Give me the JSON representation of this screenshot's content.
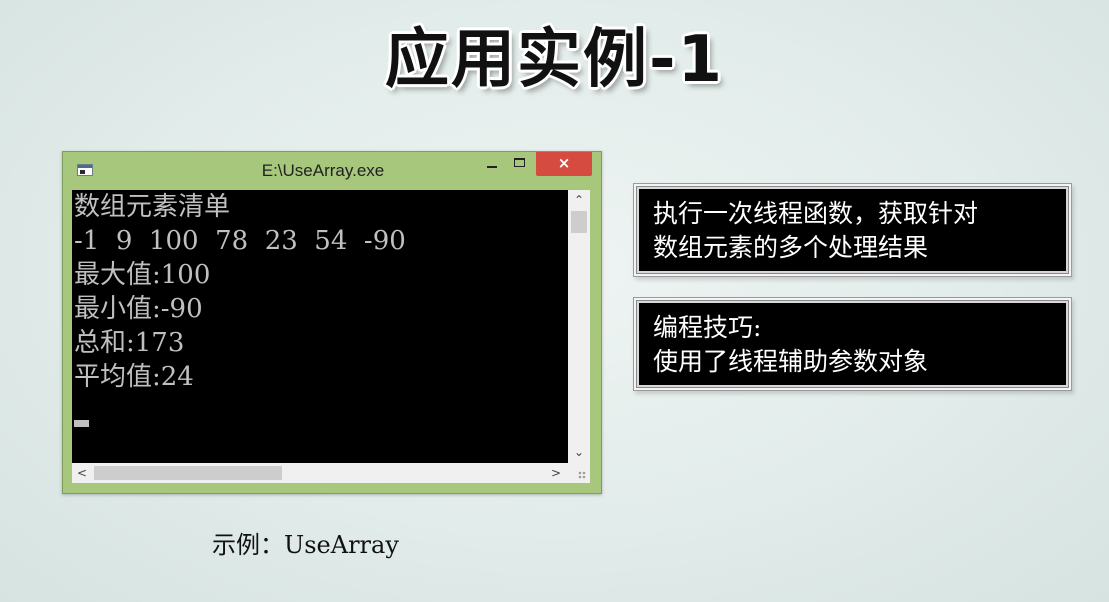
{
  "slide": {
    "title": "应用实例-1",
    "caption": "示例：UseArray"
  },
  "window": {
    "title": "E:\\UseArray.exe",
    "close_glyph": "×",
    "icons": {
      "app": "console-app-icon",
      "minimize": "minimize-icon",
      "maximize": "maximize-icon",
      "close": "close-icon"
    }
  },
  "console": {
    "lines": [
      "数组元素清单",
      "-1  9  100  78  23  54  -90",
      "最大值:100",
      "最小值:-90",
      "总和:173",
      "平均值:24"
    ]
  },
  "scrollbars": {
    "up_glyph": "⌃",
    "down_glyph": "⌄",
    "left_glyph": "<",
    "right_glyph": ">"
  },
  "notes": [
    {
      "lines": [
        "执行一次线程函数，获取针对",
        "数组元素的多个处理结果"
      ]
    },
    {
      "lines": [
        "编程技巧:",
        "使用了线程辅助参数对象"
      ]
    }
  ],
  "colors": {
    "window_frame": "#a7c77d",
    "close_button": "#d54b40",
    "console_background": "#000000",
    "console_text": "#c0c0c0",
    "note_background": "#000000",
    "note_text": "#ffffff"
  }
}
